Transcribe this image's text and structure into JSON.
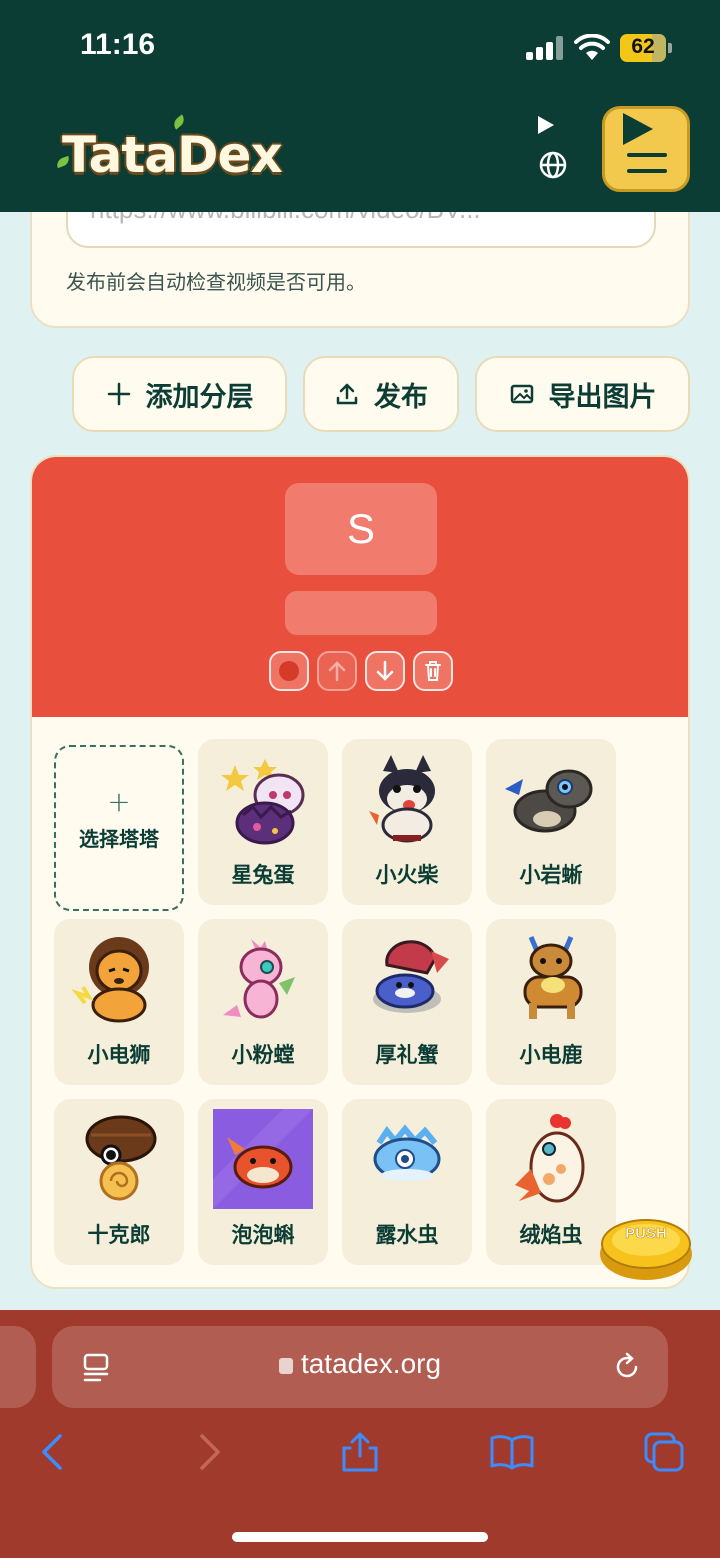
{
  "status_bar": {
    "time": "11:16",
    "battery": "62"
  },
  "header": {
    "logo": "TataDex",
    "colors": {
      "header_bg": "#0b3d35",
      "menu_button": "#f2c94c"
    }
  },
  "publish_card": {
    "video_url_placeholder": "https://www.bilibili.com/video/BV...",
    "hint": "发布前会自动检查视频是否可用。"
  },
  "actions": {
    "add_tier": "添加分层",
    "publish": "发布",
    "export_image": "导出图片"
  },
  "tier": {
    "label": "S",
    "color": "#e8503d",
    "add_slot_label": "选择塔塔",
    "add_slot_plus": "+",
    "pets": [
      {
        "name": "星兔蛋",
        "icon": "star-bunny-egg-icon"
      },
      {
        "name": "小火柴",
        "icon": "fire-shiba-icon"
      },
      {
        "name": "小岩蜥",
        "icon": "rock-lizard-icon"
      },
      {
        "name": "小电狮",
        "icon": "electric-lion-icon"
      },
      {
        "name": "小粉螳",
        "icon": "pink-mantis-icon"
      },
      {
        "name": "厚礼蟹",
        "icon": "crab-icon"
      },
      {
        "name": "小电鹿",
        "icon": "electric-deer-icon"
      },
      {
        "name": "十克郎",
        "icon": "snail-icon"
      },
      {
        "name": "泡泡蝌",
        "icon": "bubble-tadpole-icon"
      },
      {
        "name": "露水虫",
        "icon": "dew-bug-icon"
      },
      {
        "name": "绒焰虫",
        "icon": "fluff-flame-bug-icon"
      }
    ]
  },
  "push_badge": "PUSH",
  "browser": {
    "url": "tatadex.org"
  }
}
